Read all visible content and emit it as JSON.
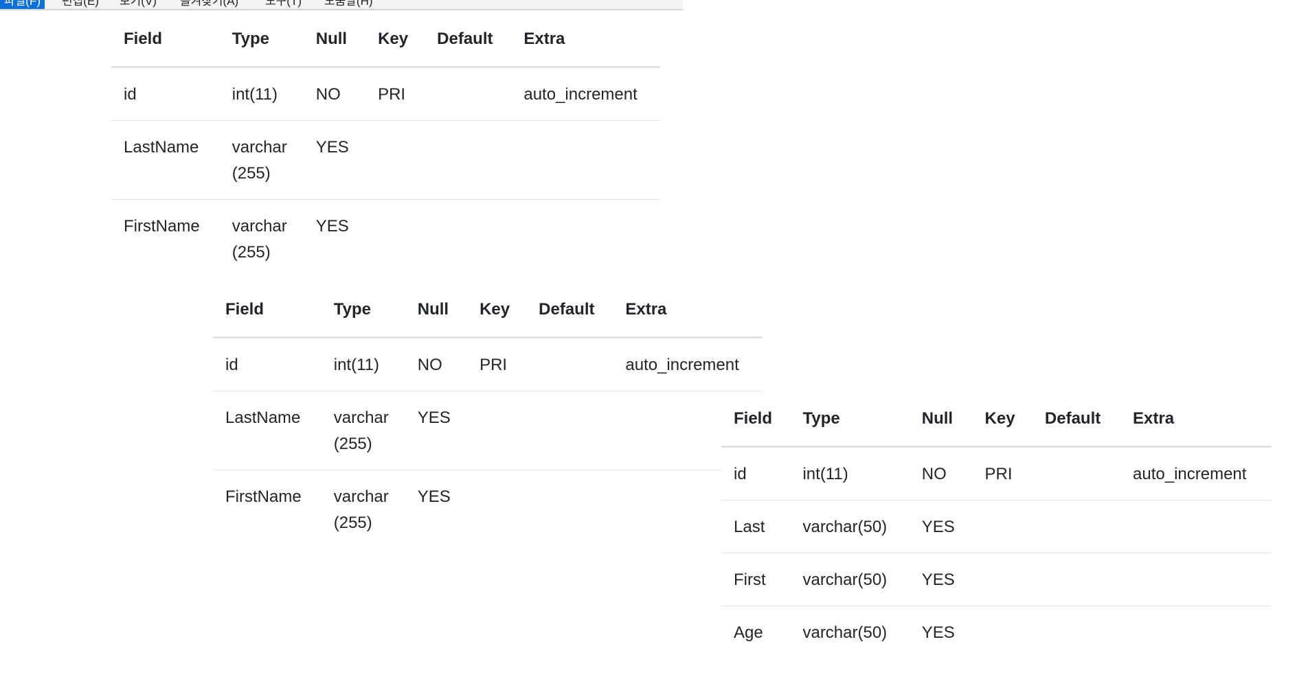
{
  "menubar": {
    "items": [
      {
        "label": "파일(F)",
        "active": true
      },
      {
        "label": "편집(E)"
      },
      {
        "label": "보기(V)"
      },
      {
        "label": "즐겨찾기(A)"
      },
      {
        "label": "도구(T)"
      },
      {
        "label": "도움말(H)"
      }
    ]
  },
  "table1": {
    "headers": [
      "Field",
      "Type",
      "Null",
      "Key",
      "Default",
      "Extra"
    ],
    "rows": [
      {
        "field": "id",
        "type": "int(11)",
        "null": "NO",
        "key": "PRI",
        "default": "",
        "extra": "auto_increment"
      },
      {
        "field": "LastName",
        "type": "varchar (255)",
        "null": "YES",
        "key": "",
        "default": "",
        "extra": ""
      },
      {
        "field": "FirstName",
        "type": "varchar (255)",
        "null": "YES",
        "key": "",
        "default": "",
        "extra": ""
      }
    ]
  },
  "table2": {
    "headers": [
      "Field",
      "Type",
      "Null",
      "Key",
      "Default",
      "Extra"
    ],
    "rows": [
      {
        "field": "id",
        "type": "int(11)",
        "null": "NO",
        "key": "PRI",
        "default": "",
        "extra": "auto_increment"
      },
      {
        "field": "LastName",
        "type": "varchar (255)",
        "null": "YES",
        "key": "",
        "default": "",
        "extra": ""
      },
      {
        "field": "FirstName",
        "type": "varchar (255)",
        "null": "YES",
        "key": "",
        "default": "",
        "extra": ""
      }
    ]
  },
  "table3": {
    "headers": [
      "Field",
      "Type",
      "Null",
      "Key",
      "Default",
      "Extra"
    ],
    "rows": [
      {
        "field": "id",
        "type": "int(11)",
        "null": "NO",
        "key": "PRI",
        "default": "",
        "extra": "auto_increment"
      },
      {
        "field": "Last",
        "type": "varchar(50)",
        "null": "YES",
        "key": "",
        "default": "",
        "extra": ""
      },
      {
        "field": "First",
        "type": "varchar(50)",
        "null": "YES",
        "key": "",
        "default": "",
        "extra": ""
      },
      {
        "field": "Age",
        "type": "varchar(50)",
        "null": "YES",
        "key": "",
        "default": "",
        "extra": ""
      }
    ]
  }
}
